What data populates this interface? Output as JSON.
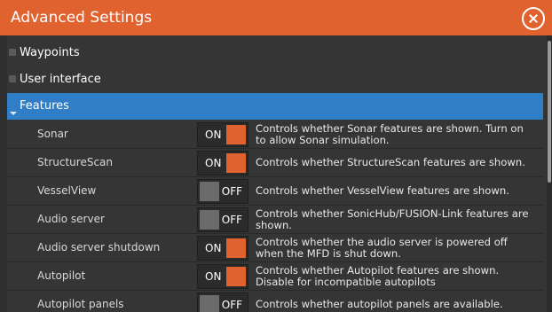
{
  "window": {
    "title": "Advanced Settings"
  },
  "sections": [
    {
      "label": "Waypoints",
      "state": "collapsed"
    },
    {
      "label": "User interface",
      "state": "collapsed"
    },
    {
      "label": "Features",
      "state": "expanded"
    }
  ],
  "features": [
    {
      "name": "Sonar",
      "toggle": "ON",
      "description": "Controls whether Sonar features are shown. Turn on to allow Sonar simulation."
    },
    {
      "name": "StructureScan",
      "toggle": "ON",
      "description": "Controls whether StructureScan features are shown."
    },
    {
      "name": "VesselView",
      "toggle": "OFF",
      "description": "Controls whether VesselView features are shown."
    },
    {
      "name": "Audio server",
      "toggle": "OFF",
      "description": "Controls whether SonicHub/FUSION-Link features are shown."
    },
    {
      "name": "Audio server shutdown",
      "toggle": "ON",
      "description": "Controls whether the audio server is powered off when the MFD is shut down."
    },
    {
      "name": "Autopilot",
      "toggle": "ON",
      "description": "Controls whether Autopilot features are shown. Disable for incompatible autopilots"
    },
    {
      "name": "Autopilot panels",
      "toggle": "OFF",
      "description": "Controls whether autopilot panels are available."
    }
  ],
  "colors": {
    "accent": "#e0622f",
    "selection": "#2f7ec6",
    "background": "#353535"
  },
  "icons": {
    "close": "close-icon",
    "expander": "chevron-right-icon"
  }
}
